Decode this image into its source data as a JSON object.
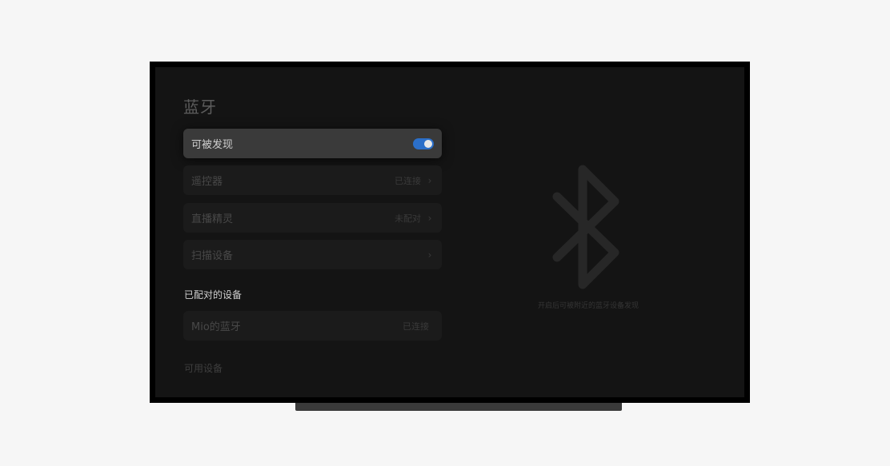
{
  "page_title": "蓝牙",
  "items": {
    "discoverable": {
      "label": "可被发现",
      "toggle_on": true
    },
    "remote": {
      "label": "遥控器",
      "status": "已连接",
      "chevron": "›"
    },
    "live": {
      "label": "直播精灵",
      "status": "未配对",
      "chevron": "›"
    },
    "scan": {
      "label": "扫描设备",
      "chevron": "›"
    }
  },
  "paired_section": {
    "title": "已配对的设备",
    "devices": [
      {
        "label": "Mio的蓝牙",
        "status": "已连接"
      }
    ]
  },
  "available_section": {
    "title": "可用设备"
  },
  "empty_hint": "开启后可被附近的蓝牙设备发现",
  "icons": {
    "bluetooth": "bluetooth-icon",
    "chevron": "chevron-right-icon"
  },
  "colors": {
    "toggle_on": "#2b6fc9"
  }
}
